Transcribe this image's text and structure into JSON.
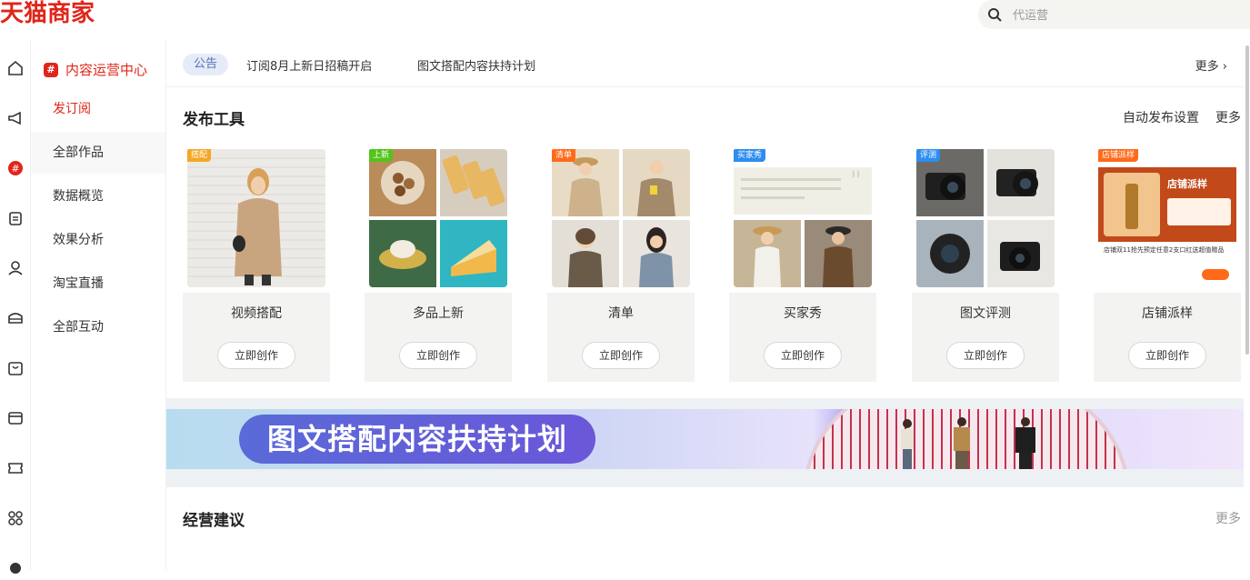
{
  "app": {
    "logo": "天猫商家"
  },
  "search": {
    "placeholder": "代运营"
  },
  "rail": {
    "icons": [
      "home-icon",
      "megaphone-icon",
      "hashtag-icon",
      "clipboard-icon",
      "user-icon",
      "shop-icon",
      "bag-icon",
      "card-icon",
      "coupon-icon",
      "apps-icon",
      "more-icon"
    ]
  },
  "nav": {
    "header": "内容运营中心",
    "items": [
      {
        "label": "发订阅"
      },
      {
        "label": "全部作品"
      },
      {
        "label": "数据概览"
      },
      {
        "label": "效果分析"
      },
      {
        "label": "淘宝直播"
      },
      {
        "label": "全部互动"
      }
    ]
  },
  "notice": {
    "tag": "公告",
    "items": [
      "订阅8月上新日招稿开启",
      "图文搭配内容扶持计划"
    ],
    "more": "更多 ›"
  },
  "publish": {
    "title": "发布工具",
    "auto_setting": "自动发布设置",
    "more": "更多",
    "cards": [
      {
        "badge": "搭配",
        "badge_color": "#f5a623",
        "label": "视频搭配",
        "button": "立即创作"
      },
      {
        "badge": "上新",
        "badge_color": "#52c41a",
        "label": "多品上新",
        "button": "立即创作"
      },
      {
        "badge": "清单",
        "badge_color": "#ff6a1a",
        "label": "清单",
        "button": "立即创作"
      },
      {
        "badge": "买家秀",
        "badge_color": "#2d8cf0",
        "label": "买家秀",
        "button": "立即创作"
      },
      {
        "badge": "评测",
        "badge_color": "#2d8cf0",
        "label": "图文评测",
        "button": "立即创作"
      },
      {
        "badge": "店铺派样",
        "badge_color": "#ff6a1a",
        "label": "店铺派样",
        "button": "立即创作",
        "inner_title": "店铺派样",
        "inner_text": "店铺双11抢先预定任意2支口红送超值赠品"
      }
    ]
  },
  "banner": {
    "text": "图文搭配内容扶持计划"
  },
  "advice": {
    "title": "经营建议",
    "more": "更多"
  },
  "colors": {
    "brand": "#e0251a",
    "accent_blue": "#5a6ad8"
  }
}
